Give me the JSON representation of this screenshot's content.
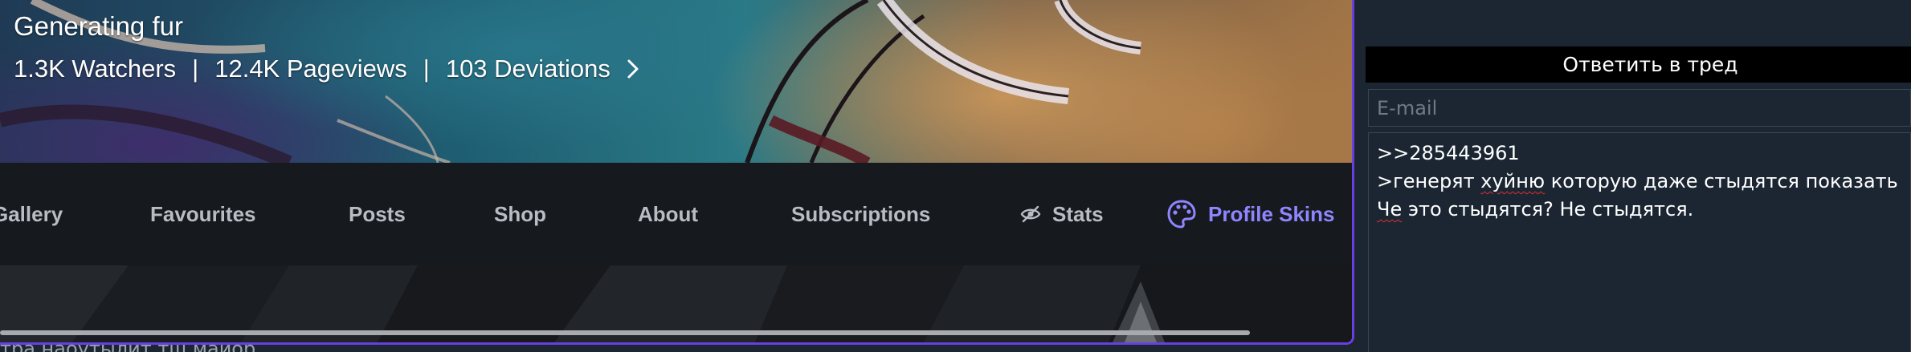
{
  "profile": {
    "banner_title": "Generating fur",
    "stats": {
      "watchers": "1.3K Watchers",
      "separator": "|",
      "pageviews": "12.4K Pageviews",
      "deviations": "103 Deviations"
    },
    "tabs": {
      "gallery": "Gallery",
      "favourites": "Favourites",
      "posts": "Posts",
      "shop": "Shop",
      "about": "About",
      "subscriptions": "Subscriptions",
      "stats": "Stats",
      "profile_skins": "Profile Skins"
    },
    "underlay_text": "тра наоутылит тш маиор",
    "colors": {
      "accent": "#6a3fe0",
      "skins": "#8f86ff",
      "tab_text": "#b9bcc3"
    }
  },
  "reply": {
    "header": "Ответить в тред",
    "email_placeholder": "E-mail",
    "message": {
      "line1": ">>285443961",
      "line2_prefix": ">генерят ",
      "line2_misspelled": "хуйню",
      "line2_suffix": " которую даже стыдятся показать",
      "line3_misspelled": "Че",
      "line3_suffix": " это стыдятся? Не стыдятся."
    }
  }
}
